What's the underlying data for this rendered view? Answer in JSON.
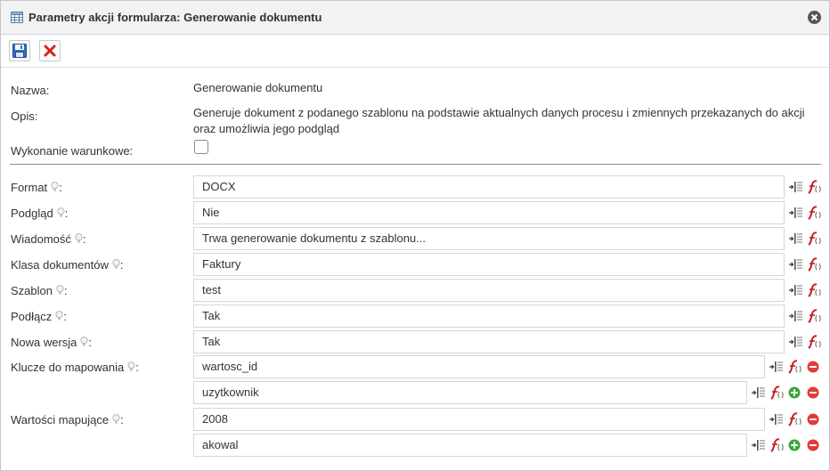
{
  "window": {
    "title": "Parametry akcji formularza: Generowanie dokumentu"
  },
  "info": {
    "name_label": "Nazwa:",
    "name_value": "Generowanie dokumentu",
    "desc_label": "Opis:",
    "desc_value_line1": "Generuje dokument z podanego szablonu na podstawie aktualnych danych procesu i zmiennych przekazanych do akcji",
    "desc_value_line2": "oraz umożliwia jego podgląd",
    "conditional_label": "Wykonanie warunkowe:",
    "conditional_checked": false
  },
  "params": [
    {
      "label": "Format",
      "value": "DOCX"
    },
    {
      "label": "Podgląd",
      "value": "Nie"
    },
    {
      "label": "Wiadomość",
      "value": "Trwa generowanie dokumentu z szablonu..."
    },
    {
      "label": "Klasa dokumentów",
      "value": "Faktury"
    },
    {
      "label": "Szablon",
      "value": "test"
    },
    {
      "label": "Podłącz",
      "value": "Tak"
    },
    {
      "label": "Nowa wersja",
      "value": "Tak"
    }
  ],
  "keys": {
    "label": "Klucze do mapowania",
    "values": [
      "wartosc_id",
      "uzytkownik"
    ]
  },
  "mapped": {
    "label": "Wartości mapujące",
    "values": [
      "2008",
      "akowal"
    ]
  },
  "colors": {
    "accent_divider": "#7c8fa3",
    "remove_red": "#e23b3b",
    "add_green": "#3aa63a"
  }
}
